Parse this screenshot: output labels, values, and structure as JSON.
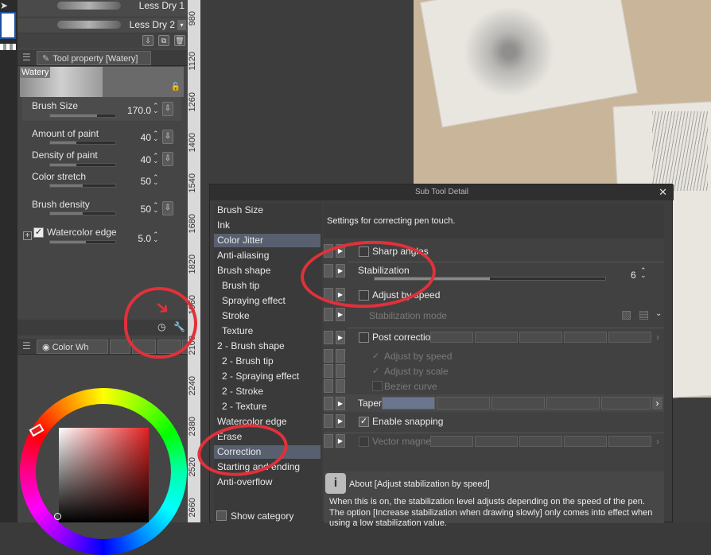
{
  "brush_list": [
    "Less Dry 1",
    "Less Dry 2"
  ],
  "tool_property": {
    "tab_label": "Tool property [Watery]",
    "preview_name": "Watery",
    "properties": [
      {
        "label": "Brush Size",
        "value": "170.0",
        "fill": 0.72
      },
      {
        "label": "Amount of paint",
        "value": "40",
        "fill": 0.4
      },
      {
        "label": "Density of paint",
        "value": "40",
        "fill": 0.4
      },
      {
        "label": "Color stretch",
        "value": "50",
        "fill": 0.5
      },
      {
        "label": "Brush density",
        "value": "50",
        "fill": 0.5
      },
      {
        "label": "Watercolor edge",
        "value": "5.0",
        "fill": 0.55
      }
    ]
  },
  "color_panel": {
    "tab_label": "Color Wh"
  },
  "ruler_ticks": [
    "980",
    "1120",
    "1260",
    "1400",
    "1540",
    "1680",
    "1820",
    "1960",
    "2100",
    "2240",
    "2380",
    "2520",
    "2660"
  ],
  "sub_tool_detail": {
    "title": "Sub Tool Detail",
    "close": "✕",
    "categories": [
      {
        "label": "Brush Size",
        "sub": false,
        "selected": false
      },
      {
        "label": "Ink",
        "sub": false,
        "selected": false
      },
      {
        "label": "Color Jitter",
        "sub": false,
        "selected": true
      },
      {
        "label": "Anti-aliasing",
        "sub": false,
        "selected": false
      },
      {
        "label": "Brush shape",
        "sub": false,
        "selected": false
      },
      {
        "label": "Brush tip",
        "sub": true,
        "selected": false
      },
      {
        "label": "Spraying effect",
        "sub": true,
        "selected": false
      },
      {
        "label": "Stroke",
        "sub": true,
        "selected": false
      },
      {
        "label": "Texture",
        "sub": true,
        "selected": false
      },
      {
        "label": "2 - Brush shape",
        "sub": false,
        "selected": false
      },
      {
        "label": "2 - Brush tip",
        "sub": true,
        "selected": false
      },
      {
        "label": "2 - Spraying effect",
        "sub": true,
        "selected": false
      },
      {
        "label": "2 - Stroke",
        "sub": true,
        "selected": false
      },
      {
        "label": "2 - Texture",
        "sub": true,
        "selected": false
      },
      {
        "label": "Watercolor edge",
        "sub": false,
        "selected": false
      },
      {
        "label": "Erase",
        "sub": false,
        "selected": false
      },
      {
        "label": "Correction",
        "sub": false,
        "selected": true
      },
      {
        "label": "Starting and ending",
        "sub": false,
        "selected": false
      },
      {
        "label": "Anti-overflow",
        "sub": false,
        "selected": false
      }
    ],
    "show_category": "Show category",
    "header_text": "Settings for correcting pen touch.",
    "settings": {
      "sharp_angles": "Sharp angles",
      "stabilization": "Stabilization",
      "stabilization_value": "6",
      "stabilization_fill": 0.5,
      "adjust_by_speed": "Adjust by speed",
      "stabilization_mode": "Stabilization mode",
      "post_correction": "Post correction",
      "adjust_by_speed_2": "Adjust by speed",
      "adjust_by_scale": "Adjust by scale",
      "bezier_curve": "Bezier curve",
      "taper": "Taper",
      "enable_snapping": "Enable snapping",
      "vector_magnet": "Vector magnet"
    },
    "about": {
      "title": "About [Adjust stabilization by speed]",
      "text1": "When this is on, the stabilization level adjusts depending on the speed of the pen.",
      "text2": "The option [Increase stabilization when drawing slowly] only comes into effect when using a low stabilization value."
    }
  },
  "colors": {
    "annotation": "#e0313b",
    "selected": "#586070",
    "wheel_sv": "#e32121"
  }
}
